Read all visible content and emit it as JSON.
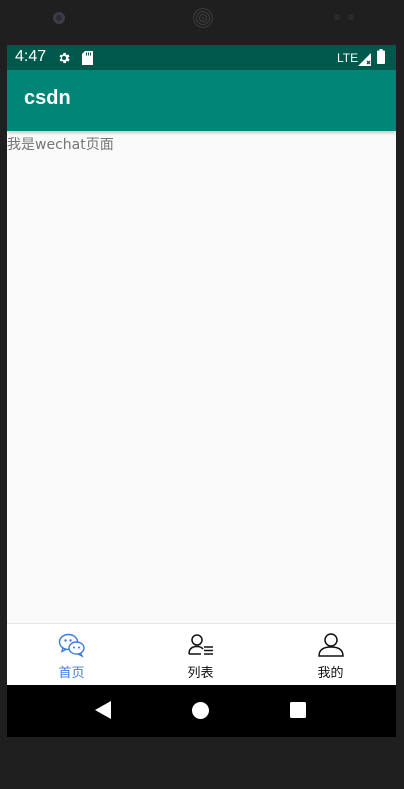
{
  "status_bar": {
    "time": "4:47",
    "network": "LTE",
    "icons": [
      "settings-gear-icon",
      "sd-card-icon",
      "signal-icon",
      "battery-icon"
    ],
    "background": "#00574b"
  },
  "app_bar": {
    "title": "csdn",
    "background": "#008577"
  },
  "content": {
    "text": "我是wechat页面"
  },
  "bottom_nav": {
    "active_color": "#3b7be0",
    "items": [
      {
        "label": "首页",
        "icon": "wechat-icon",
        "active": true
      },
      {
        "label": "列表",
        "icon": "contacts-list-icon",
        "active": false
      },
      {
        "label": "我的",
        "icon": "profile-icon",
        "active": false
      }
    ]
  },
  "system_nav": {
    "icons": [
      "back-icon",
      "home-icon",
      "recents-icon"
    ]
  }
}
